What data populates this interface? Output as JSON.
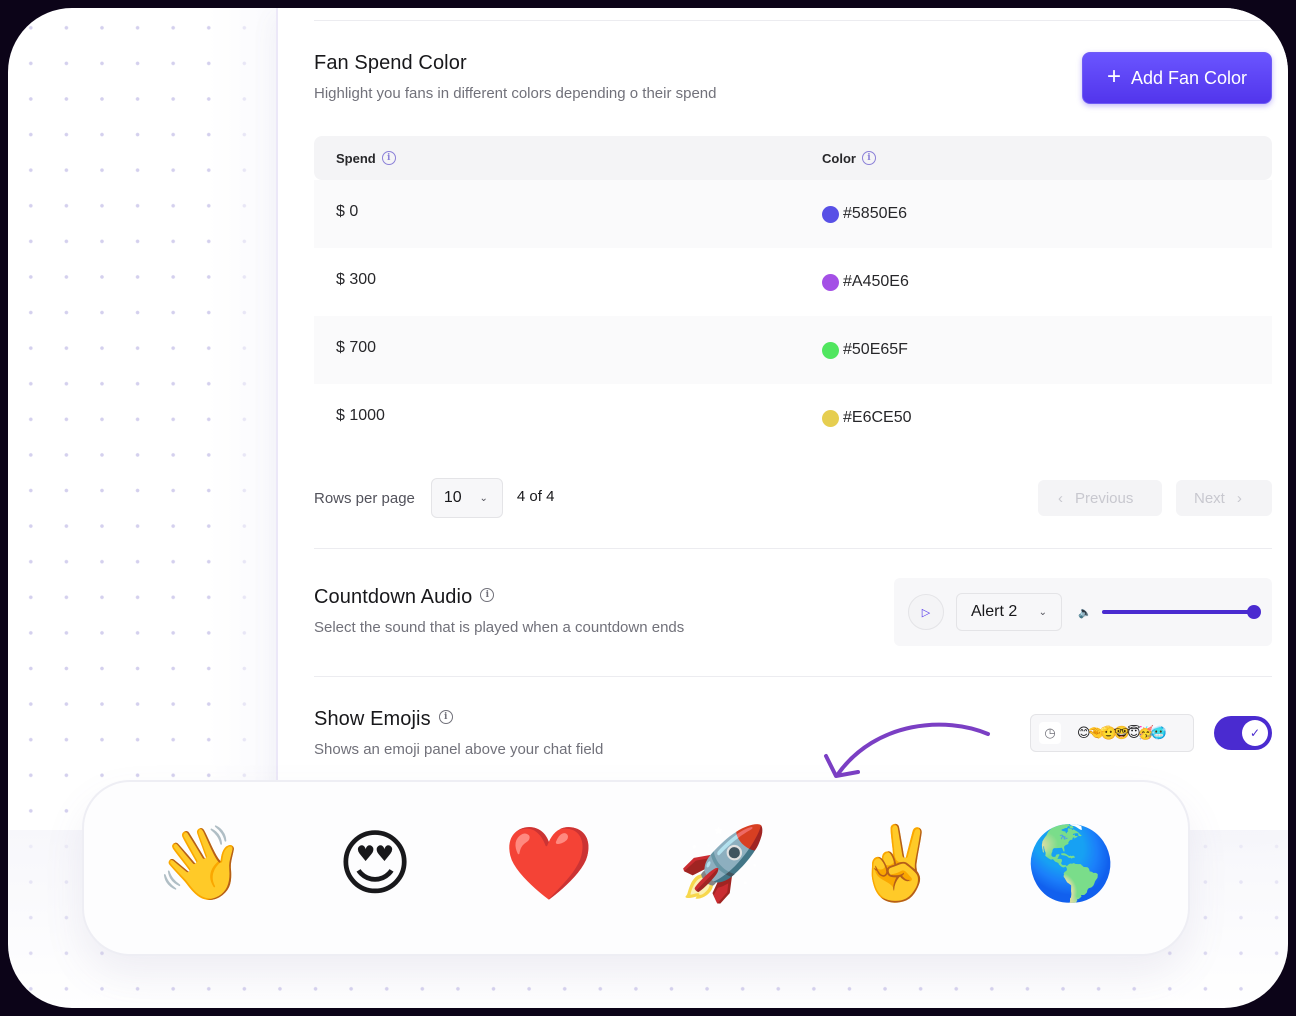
{
  "fan_spend": {
    "title": "Fan Spend Color",
    "subtitle": "Highlight you fans in different colors depending o their spend",
    "add_button_label": "Add Fan Color",
    "add_button_icon": "plus-icon",
    "columns": [
      {
        "label": "Spend",
        "icon": "info-icon"
      },
      {
        "label": "Color",
        "icon": "info-icon"
      }
    ],
    "rows": [
      {
        "spend": "$ 0",
        "color_hex": "#5850E6",
        "color_label": "#5850E6"
      },
      {
        "spend": "$ 300",
        "color_hex": "#A450E6",
        "color_label": "#A450E6"
      },
      {
        "spend": "$ 700",
        "color_hex": "#50E65F",
        "color_label": "#50E65F"
      },
      {
        "spend": "$ 1000",
        "color_hex": "#E6CE50",
        "color_label": "#E6CE50"
      }
    ],
    "pagination": {
      "rows_per_page_label": "Rows per page",
      "rows_per_page_value": "10",
      "page_count": "4 of 4",
      "previous_label": "Previous",
      "next_label": "Next"
    }
  },
  "countdown_audio": {
    "title": "Countdown Audio",
    "subtitle": "Select the sound that is played when a countdown ends",
    "selected_sound": "Alert 2",
    "volume_percent": 100
  },
  "show_emojis": {
    "title": "Show Emojis",
    "subtitle": "Shows an emoji panel above your chat field",
    "preview_emojis": "😊🤏🫡🤓😇🥳🥶",
    "enabled": true
  },
  "emoji_panel": {
    "emojis": [
      "👋",
      "😍",
      "❤️",
      "🚀",
      "✌️",
      "🌎"
    ]
  },
  "colors": {
    "accent": "#5235EC",
    "toggle": "#4A2BD0",
    "arrow": "#7B3FC4"
  }
}
